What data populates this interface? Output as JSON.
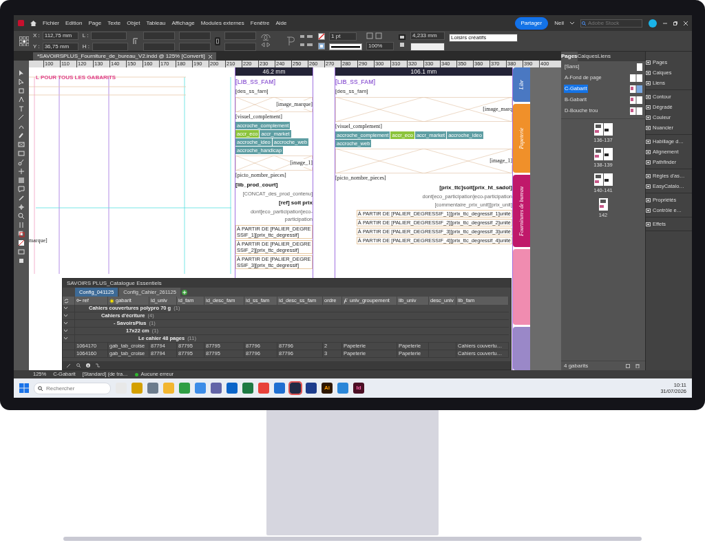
{
  "window": {
    "title": "*SAVOIRSPLUS_Fourniture_de_bureau_V2.indd @ 125% [Converti]"
  },
  "menu": [
    "Fichier",
    "Edition",
    "Page",
    "Texte",
    "Objet",
    "Tableau",
    "Affichage",
    "Modules externes",
    "Fenêtre",
    "Aide"
  ],
  "topbar": {
    "share": "Partager",
    "user": "Neil",
    "search": {
      "placeholder": "Adobe Stock"
    }
  },
  "control_bar": {
    "x_label": "X :",
    "x": "112,75 mm",
    "y_label": "Y :",
    "y": "36,75 mm",
    "w_label": "L :",
    "h_label": "H :",
    "stroke": "1 pt",
    "opacity": "100%",
    "spacing": "4,233 mm",
    "style": "Loisirs créatifs"
  },
  "ruler": [
    "100",
    "110",
    "120",
    "130",
    "140",
    "150",
    "160",
    "170",
    "180",
    "190",
    "200",
    "210",
    "220",
    "230",
    "240",
    "250",
    "260",
    "270",
    "280",
    "290",
    "300",
    "310",
    "320",
    "330",
    "340",
    "350",
    "360",
    "370",
    "380",
    "390",
    "400"
  ],
  "canvas": {
    "page_heading": "L POUR TOUS LES GABARITS",
    "left_label": "marque]",
    "blocks": [
      {
        "width_label": "46.2 mm",
        "items": [
          {
            "kind": "title",
            "text": "[LIB_SS_FAM]"
          },
          {
            "kind": "text",
            "text": "[des_ss_fam]"
          },
          {
            "kind": "frame",
            "text": "[image_marque]"
          },
          {
            "kind": "label",
            "text": "[visuel_complement]"
          },
          {
            "kind": "tag",
            "text": "accroche_complement",
            "color": "#5e9ea3"
          },
          {
            "kind": "tag",
            "text": "accr_eco",
            "color": "#8cc43c"
          },
          {
            "kind": "tag",
            "text": "accr_market",
            "color": "#5e9ea3"
          },
          {
            "kind": "tag",
            "text": "accroche_ideo",
            "color": "#5e9ea3"
          },
          {
            "kind": "tag",
            "text": "accroche_web",
            "color": "#5e9ea3"
          },
          {
            "kind": "tag",
            "text": "accroche_handicap",
            "color": "#5e9ea3"
          },
          {
            "kind": "frame",
            "text": "[image_1]"
          },
          {
            "kind": "label",
            "text": "[picto_nombre_pieces]"
          },
          {
            "kind": "title2",
            "text": "[lib_prod_court]"
          },
          {
            "kind": "small",
            "text": "[CONCAT_des_prod_contenu]"
          },
          {
            "kind": "price",
            "text": "[ref] soit prix"
          },
          {
            "kind": "small",
            "text": "dont[eco_participation]eco-participation"
          },
          {
            "kind": "tier",
            "text": "À PARTIR DE [PALIER_DEGRESSIF_1][prix_ttc_degressif]"
          },
          {
            "kind": "tier",
            "text": "À PARTIR DE [PALIER_DEGRESSIF_2][prix_ttc_degressif]"
          },
          {
            "kind": "tier",
            "text": "À PARTIR DE [PALIER_DEGRESSIF_3][prix_ttc_degressif]"
          }
        ]
      },
      {
        "width_label": "106.1 mm",
        "items": [
          {
            "kind": "title",
            "text": "[LIB_SS_FAM]"
          },
          {
            "kind": "text",
            "text": "[des_ss_fam]"
          },
          {
            "kind": "frame",
            "text": "[image_marq"
          },
          {
            "kind": "label",
            "text": "[visuel_complement]"
          },
          {
            "kind": "tag",
            "text": "accroche_complement",
            "color": "#5e9ea3"
          },
          {
            "kind": "tag",
            "text": "accr_eco",
            "color": "#8cc43c"
          },
          {
            "kind": "tag",
            "text": "accr_market",
            "color": "#5e9ea3"
          },
          {
            "kind": "tag",
            "text": "accroche_ideo",
            "color": "#5e9ea3"
          },
          {
            "kind": "tag",
            "text": "accroche_web",
            "color": "#5e9ea3"
          },
          {
            "kind": "frame",
            "text": "[image_1]"
          },
          {
            "kind": "label",
            "text": "[picto_nombre_pieces]"
          },
          {
            "kind": "price",
            "text": "[prix_ttc]soit[prix_ht_sadol]"
          },
          {
            "kind": "small",
            "text": "dont[eco_participation]eco-participation"
          },
          {
            "kind": "small",
            "text": "[commentaire_prix_unit][prix_unit]"
          },
          {
            "kind": "tier",
            "text": "À PARTIR DE [PALIER_DEGRESSIF_1][prix_ttc_degressif_1]unité"
          },
          {
            "kind": "tier",
            "text": "À PARTIR DE [PALIER_DEGRESSIF_2][prix_ttc_degressif_2]unité"
          },
          {
            "kind": "tier",
            "text": "À PARTIR DE [PALIER_DEGRESSIF_3][prix_ttc_degressif_3]unité"
          },
          {
            "kind": "tier",
            "text": "À PARTIR DE [PALIER_DEGRESSIF_4][prix_ttc_degressif_4]unité"
          }
        ]
      }
    ],
    "section_tabs": [
      {
        "label": "Libr",
        "color": "#4a78c2"
      },
      {
        "label": "Papeterie",
        "color": "#f0902a"
      },
      {
        "label": "Fournitures de bureau",
        "color": "#c0186a"
      },
      {
        "color": "#f08cb0"
      },
      {
        "color": "#9a88c8"
      }
    ]
  },
  "pages_panel": {
    "tabs": [
      {
        "label": "Pages",
        "selected": true
      },
      {
        "label": "Calques",
        "selected": false
      },
      {
        "label": "Liens",
        "selected": false
      }
    ],
    "masters": [
      {
        "label": "[Sans]",
        "selected": false
      },
      {
        "label": "A-Fond de page",
        "selected": false
      },
      {
        "label": "C-Gabarit",
        "selected": true
      },
      {
        "label": "B-Gabarit",
        "selected": false
      },
      {
        "label": "D-Bouche trou",
        "selected": false
      }
    ],
    "spreads": [
      "136-137",
      "138-139",
      "140-141",
      "142"
    ],
    "footer": "4 gabarits"
  },
  "side_panels": [
    [
      "Pages",
      "Calques",
      "Liens"
    ],
    [
      "Contour",
      "Dégradé",
      "Couleur",
      "Nuancier"
    ],
    [
      "Habillage d…",
      "Alignement",
      "Pathfinder"
    ],
    [
      "Règles d'as…",
      "EasyCatalo…"
    ],
    [
      "Propriétés",
      "Contrôle e…"
    ],
    [
      "Effets"
    ]
  ],
  "data_panel": {
    "title": "SAVOIRS PLUS_Catalogue Essentiels",
    "tabs": [
      {
        "label": "Config_041125",
        "selected": true
      },
      {
        "label": "Config_Cahier_261125",
        "selected": false
      }
    ],
    "columns": [
      "ref",
      "gabarit",
      "id_univ",
      "id_fam",
      "id_desc_fam",
      "id_ss_fam",
      "id_desc_ss_fam",
      "ordre",
      "univ_groupement",
      "lib_univ",
      "desc_univ",
      "lib_fam"
    ],
    "groups": [
      {
        "label": "Cahiers couvertures polypro 70 g",
        "count": "(1)",
        "expanded": true,
        "children": [
          {
            "label": "Cahiers d'écriture",
            "count": "(4)",
            "expanded": true,
            "children": [
              {
                "label": "- SavoirsPlus",
                "count": "(1)",
                "expanded": true,
                "children": [
                  {
                    "label": "17x22 cm",
                    "count": "(1)",
                    "expanded": true,
                    "children": [
                      {
                        "label": "Le cahier 48 pages",
                        "count": "(11)",
                        "expanded": true
                      }
                    ]
                  }
                ]
              }
            ]
          }
        ]
      }
    ],
    "rows": [
      [
        "1064170",
        "gab_tab_croise",
        "87794",
        "87795",
        "87795",
        "87796",
        "87796",
        "2",
        "Papeterie",
        "Papeterie",
        null,
        "Cahiers couvertu…"
      ],
      [
        "1064160",
        "gab_tab_croise",
        "87794",
        "87795",
        "87795",
        "87796",
        "87796",
        "3",
        "Papeterie",
        "Papeterie",
        null,
        "Cahiers couvertu…"
      ]
    ]
  },
  "status_bar": {
    "zoom": "125%",
    "master": "C-Gabarit",
    "profile": "[Standard] (de tra…",
    "preflight": "Aucune erreur"
  },
  "taskbar": {
    "search": {
      "placeholder": "Rechercher"
    },
    "apps": [
      {
        "color": "#e8e8e8",
        "selected": false
      },
      {
        "color": "#d4a000",
        "selected": false
      },
      {
        "color": "#6b7b8c",
        "selected": false
      },
      {
        "color": "#f2b630",
        "selected": false
      },
      {
        "color": "#2f9e44",
        "selected": false
      },
      {
        "color": "#3c8ce7",
        "selected": false
      },
      {
        "color": "#6264a7",
        "selected": false
      },
      {
        "color": "#0a64c8",
        "selected": false
      },
      {
        "color": "#1d7a43",
        "selected": false
      },
      {
        "color": "#e8413a",
        "selected": false
      },
      {
        "color": "#1f6fd1",
        "selected": false
      },
      {
        "color": "#222a44",
        "selected": true
      },
      {
        "color": "#1c3c8c",
        "selected": false
      },
      {
        "color": "#2e1700",
        "label": "Ai",
        "selected": false
      },
      {
        "color": "#2a86d8",
        "selected": false
      },
      {
        "color": "#4b0f24",
        "label": "Id",
        "selected": false
      }
    ],
    "time": "10:11",
    "date": "31/07/2026"
  }
}
